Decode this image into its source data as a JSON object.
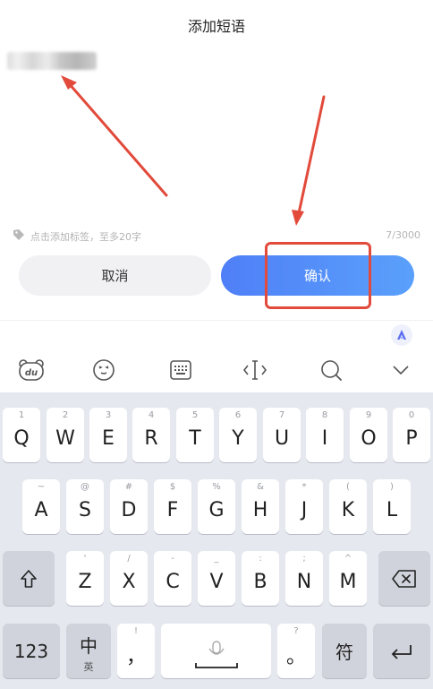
{
  "header": {
    "title": "添加短语"
  },
  "editor": {
    "tag_hint": "点击添加标签，至多20字",
    "counter": "7/3000"
  },
  "buttons": {
    "cancel": "取消",
    "confirm": "确认"
  },
  "keyboard": {
    "row1": [
      {
        "sub": "1",
        "main": "Q"
      },
      {
        "sub": "2",
        "main": "W"
      },
      {
        "sub": "3",
        "main": "E"
      },
      {
        "sub": "4",
        "main": "R"
      },
      {
        "sub": "5",
        "main": "T"
      },
      {
        "sub": "6",
        "main": "Y"
      },
      {
        "sub": "7",
        "main": "U"
      },
      {
        "sub": "8",
        "main": "I"
      },
      {
        "sub": "9",
        "main": "O"
      },
      {
        "sub": "0",
        "main": "P"
      }
    ],
    "row2": [
      {
        "sub": "~",
        "main": "A"
      },
      {
        "sub": "@",
        "main": "S"
      },
      {
        "sub": "#",
        "main": "D"
      },
      {
        "sub": "$",
        "main": "F"
      },
      {
        "sub": "%",
        "main": "G"
      },
      {
        "sub": "&",
        "main": "H"
      },
      {
        "sub": "*",
        "main": "J"
      },
      {
        "sub": "(",
        "main": "K"
      },
      {
        "sub": ")",
        "main": "L"
      }
    ],
    "row3": [
      {
        "sub": "'",
        "main": "Z"
      },
      {
        "sub": "/",
        "main": "X"
      },
      {
        "sub": "-",
        "main": "C"
      },
      {
        "sub": "_",
        "main": "V"
      },
      {
        "sub": ":",
        "main": "B"
      },
      {
        "sub": ";",
        "main": "N"
      },
      {
        "sub": "^",
        "main": "M"
      }
    ],
    "num_key": "123",
    "lang_key_main": "中",
    "lang_key_sub": "英",
    "comma_key_sub": "!",
    "comma_key_main": "，",
    "period_key_sub": "?",
    "period_key_main": "。",
    "symbol_key": "符"
  },
  "icons": {
    "toolbar": [
      "du-bear-icon",
      "emoji-icon",
      "keyboard-icon",
      "cursor-icon",
      "search-icon",
      "collapse-chevron-icon"
    ]
  }
}
